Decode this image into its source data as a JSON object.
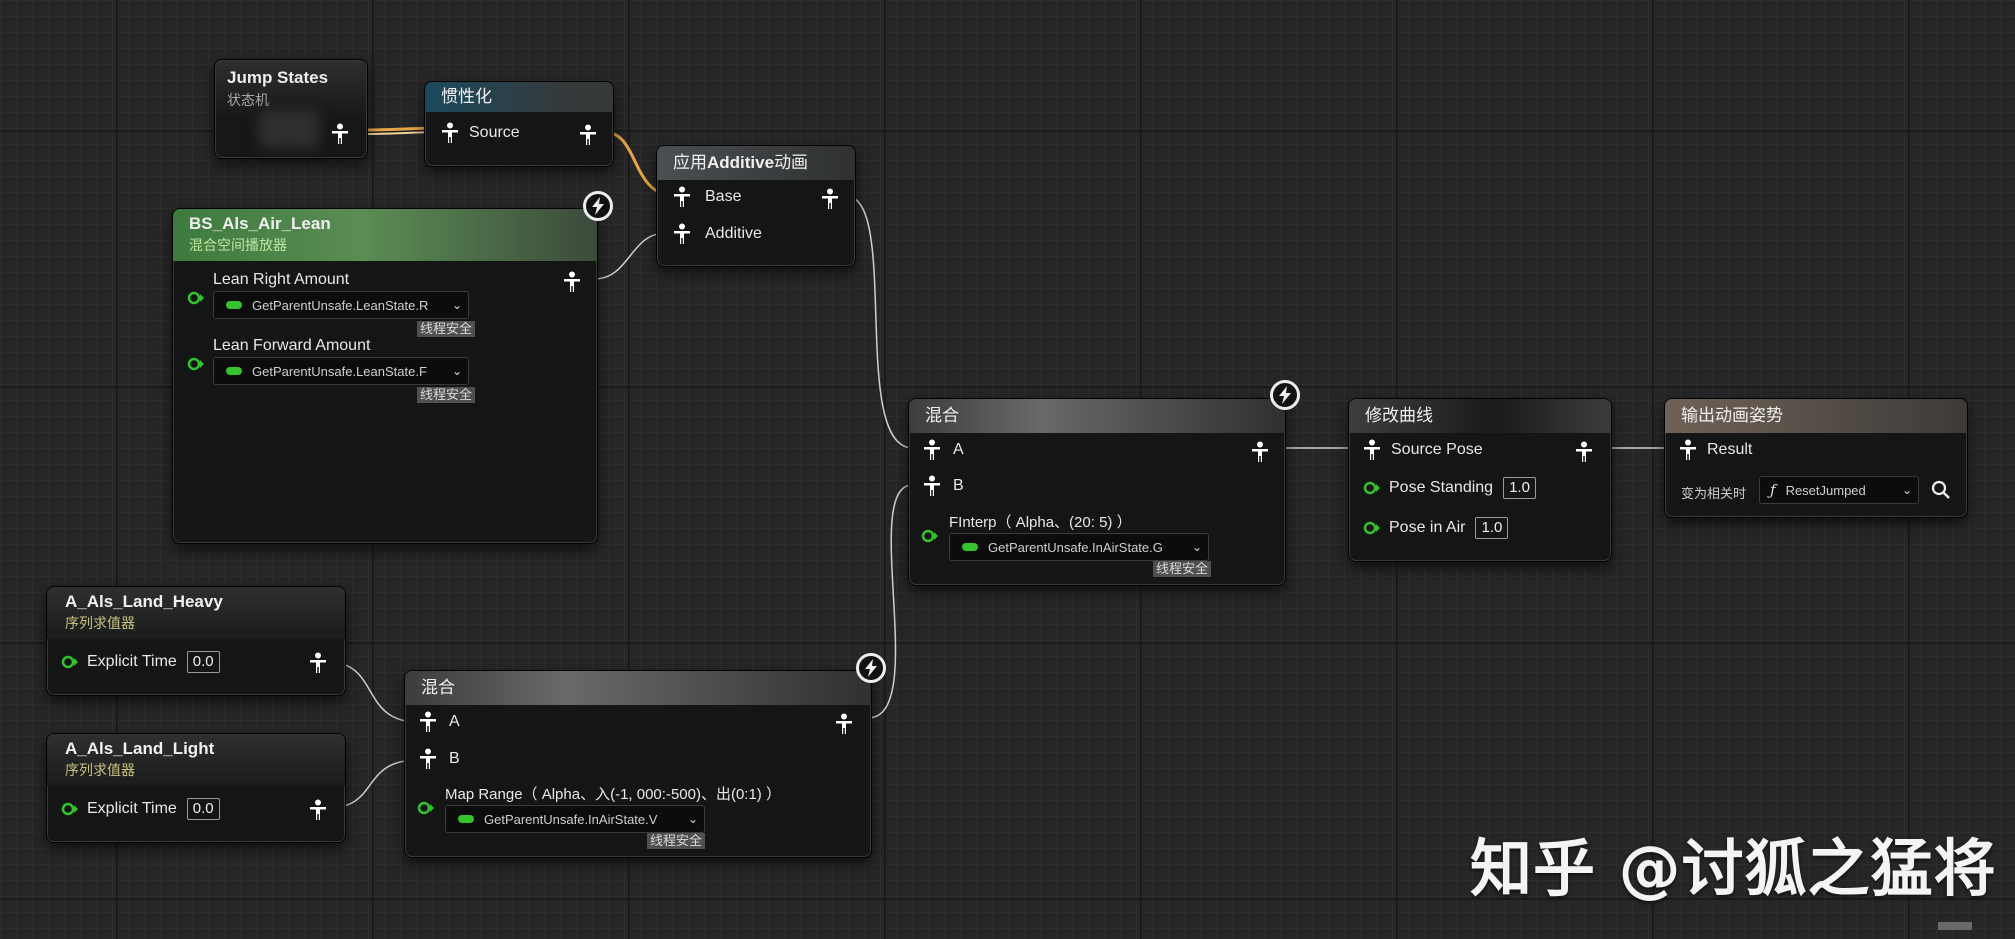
{
  "colors": {
    "background": "#262626",
    "node_body": "#141515",
    "pose_wire": "#d9d9d9",
    "exec_wire_orange": "#e3a545",
    "float_pin_green": "#35c22f"
  },
  "nodes": {
    "jump_states": {
      "title": "Jump States",
      "subtitle": "状态机"
    },
    "inertialization": {
      "title": "惯性化",
      "pin_source": "Source"
    },
    "apply_additive": {
      "title_prefix": "应用",
      "title_bold": "Additive",
      "title_suffix": "动画",
      "pin_base": "Base",
      "pin_additive": "Additive"
    },
    "bs_air_lean": {
      "title": "BS_Als_Air_Lean",
      "subtitle": "混合空间播放器",
      "lean_right_label": "Lean Right Amount",
      "lean_right_binding": "GetParentUnsafe.LeanState.R",
      "lean_forward_label": "Lean Forward Amount",
      "lean_forward_binding": "GetParentUnsafe.LeanState.F",
      "thread_safe": "线程安全"
    },
    "blend_main": {
      "title": "混合",
      "pin_a": "A",
      "pin_b": "B",
      "alpha_label": "FInterp（ Alpha、(20: 5) ）",
      "alpha_binding": "GetParentUnsafe.InAirState.G",
      "thread_safe": "线程安全"
    },
    "modify_curve": {
      "title": "修改曲线",
      "pin_source": "Source Pose",
      "pose_standing_label": "Pose Standing",
      "pose_standing_value": "1.0",
      "pose_in_air_label": "Pose in Air",
      "pose_in_air_value": "1.0"
    },
    "output_pose": {
      "title": "输出动画姿势",
      "pin_result": "Result",
      "relevancy_label": "变为相关时",
      "function_name": "ResetJumped"
    },
    "land_heavy": {
      "title": "A_Als_Land_Heavy",
      "subtitle": "序列求值器",
      "explicit_time_label": "Explicit Time",
      "explicit_time_value": "0.0"
    },
    "land_light": {
      "title": "A_Als_Land_Light",
      "subtitle": "序列求值器",
      "explicit_time_label": "Explicit Time",
      "explicit_time_value": "0.0"
    },
    "blend_land": {
      "title": "混合",
      "pin_a": "A",
      "pin_b": "B",
      "alpha_label": "Map Range（ Alpha、入(-1, 000:-500)、出(0:1) ）",
      "alpha_binding": "GetParentUnsafe.InAirState.V",
      "thread_safe": "线程安全"
    }
  },
  "icons": {
    "pose_pin": "person-pose-icon",
    "float_pin": "float-pin-icon",
    "fast_path": "lightning-bolt-icon",
    "dropdown": "chevron-down-icon",
    "search": "search-icon",
    "function": "function-icon"
  },
  "watermark": "知乎 @讨狐之猛将"
}
